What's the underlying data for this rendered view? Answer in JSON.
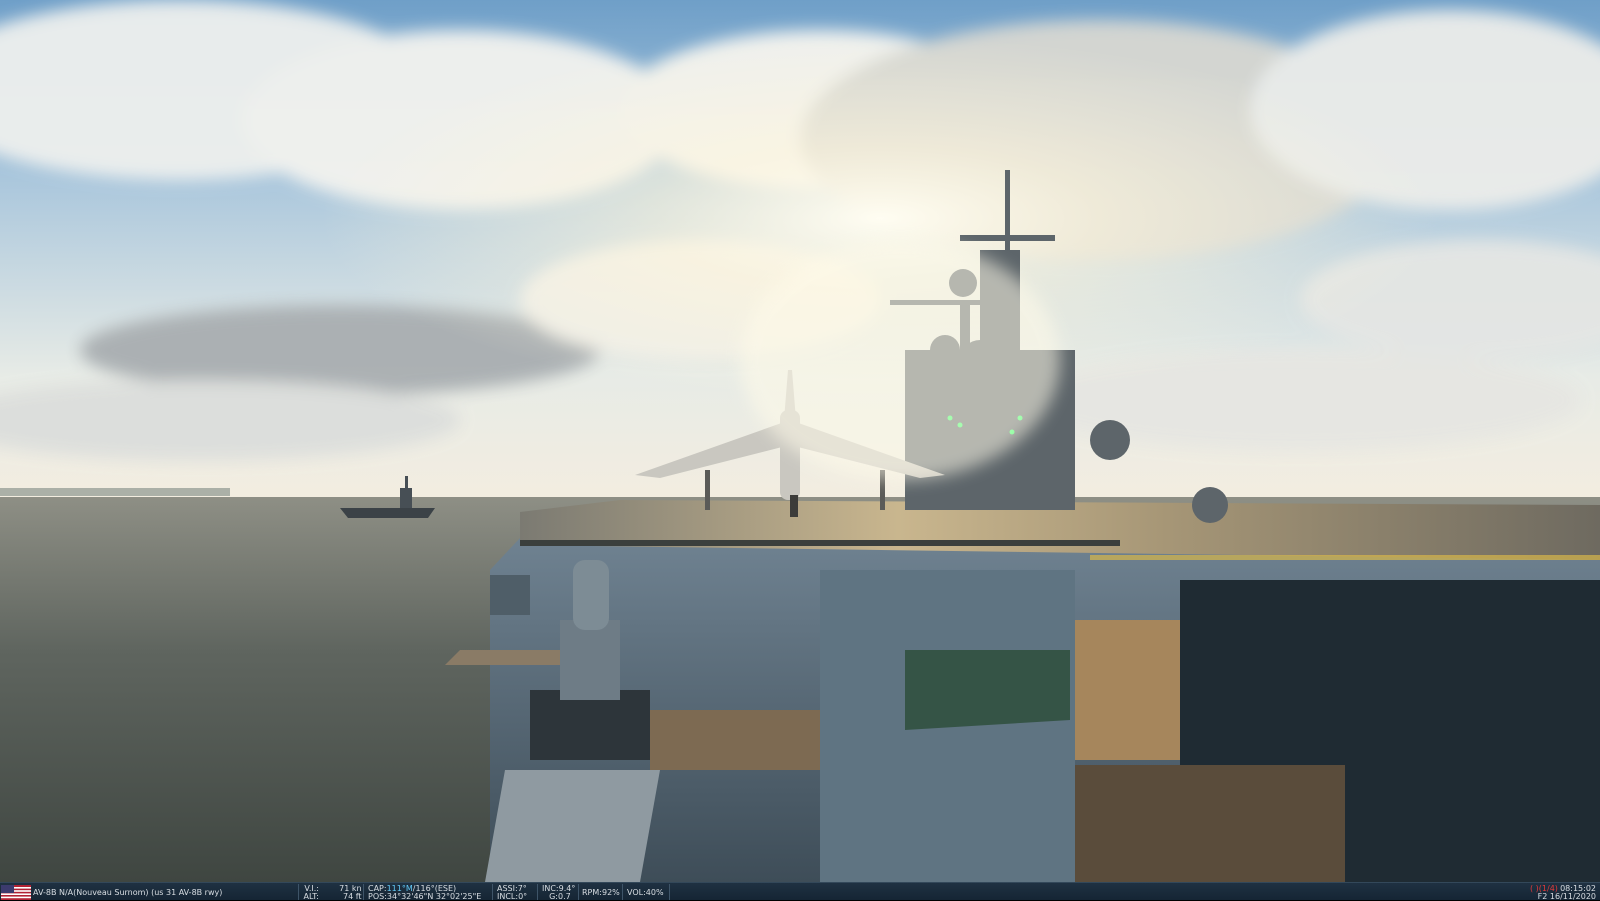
{
  "scene": {
    "description_icons": [
      "carrier-deck",
      "harrier-jet",
      "island-superstructure",
      "distant-carrier",
      "ocean",
      "cloudy-sky"
    ]
  },
  "status_bar": {
    "flag_icon": "us-flag-icon",
    "unit": "AV-8B N/A(Nouveau Surnom) (us 31 AV-8B rwy)",
    "vi_label": "V.I.:",
    "vi_value": "71 kn",
    "alt_label": "ALT:",
    "alt_value": "74 ft",
    "cap_label": "CAP:",
    "cap_mag": "111°M",
    "cap_true": "/116°(ESE)",
    "pos_label": "POS:",
    "pos_value": "34°32'46\"N 32°02'25\"E",
    "assi_label": "ASSI:",
    "assi_value": "7°",
    "incl_label": "INCL:",
    "incl_value": "0°",
    "inc_label": "INC:",
    "inc_value": "9.4°",
    "g_label": "G:",
    "g_value": "0.7",
    "rpm_label": "RPM:",
    "rpm_value": "92%",
    "vol_label": "VOL:",
    "vol_value": "40%",
    "counter": "( )(1/4)",
    "time": "08:15:02",
    "date": "F2 16/11/2020"
  }
}
